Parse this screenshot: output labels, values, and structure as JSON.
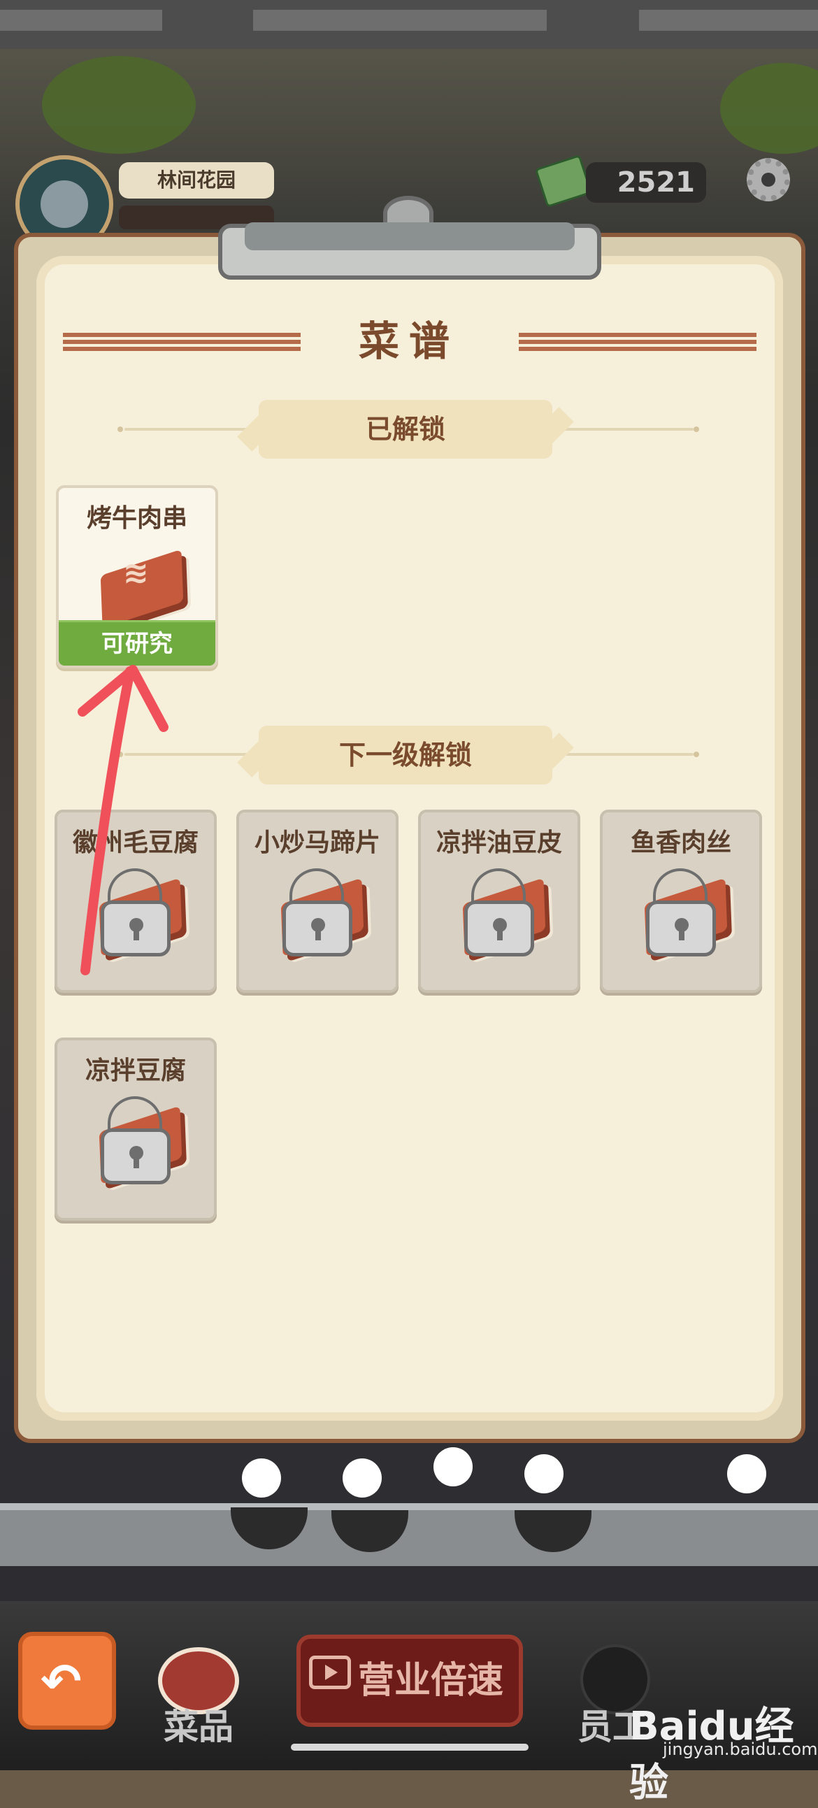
{
  "hud": {
    "restaurant_name": "林间花园",
    "money": "2521"
  },
  "panel": {
    "title": "菜谱",
    "unlocked_section_label": "已解锁",
    "next_level_section_label": "下一级解锁",
    "unlocked_recipes": [
      {
        "name": "烤牛肉串",
        "status": "可研究"
      }
    ],
    "locked_recipes": [
      {
        "name": "徽州毛豆腐"
      },
      {
        "name": "小炒马蹄片"
      },
      {
        "name": "凉拌油豆皮"
      },
      {
        "name": "鱼香肉丝"
      },
      {
        "name": "凉拌豆腐"
      }
    ]
  },
  "bottom_nav": {
    "dishes_label": "菜品",
    "speed_label": "营业倍速",
    "staff_label": "员工"
  },
  "watermark": {
    "brand": "Baidu经验",
    "url": "jingyan.baidu.com"
  },
  "colors": {
    "panel_bg": "#f6efda",
    "title_brown": "#7b4a2c",
    "research_green": "#6fab3e",
    "back_orange": "#f07a3b",
    "annotation_arrow": "#f0505a"
  }
}
